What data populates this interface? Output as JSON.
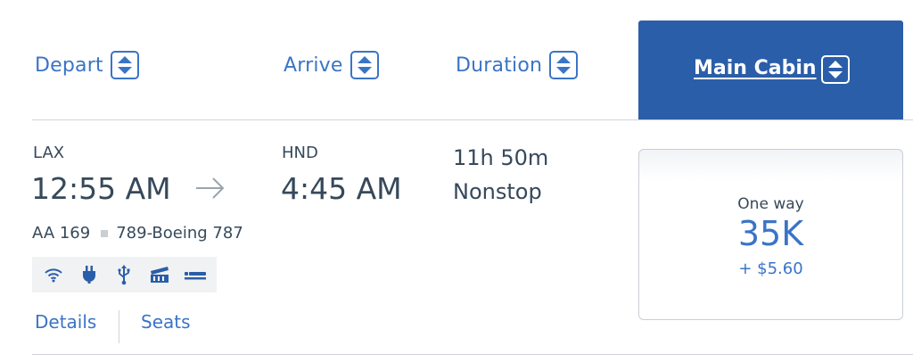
{
  "header": {
    "depart_label": "Depart",
    "arrive_label": "Arrive",
    "duration_label": "Duration",
    "cabin_label": "Main Cabin"
  },
  "flight": {
    "origin": "LAX",
    "departure_time": "12:55 AM",
    "destination": "HND",
    "arrival_time": "4:45 AM",
    "duration": "11h 50m",
    "stops": "Nonstop",
    "flight_number": "AA 169",
    "aircraft": "789-Boeing 787",
    "amenities": [
      "wifi-icon",
      "power-outlet-icon",
      "usb-icon",
      "entertainment-icon",
      "lie-flat-seat-icon"
    ]
  },
  "links": {
    "details": "Details",
    "seats": "Seats"
  },
  "fare": {
    "trip_type": "One way",
    "miles": "35K",
    "taxes": "+ $5.60"
  },
  "colors": {
    "accent_blue": "#3a74c7",
    "cabin_tab_bg": "#2b5ea8",
    "text": "#36495a"
  }
}
